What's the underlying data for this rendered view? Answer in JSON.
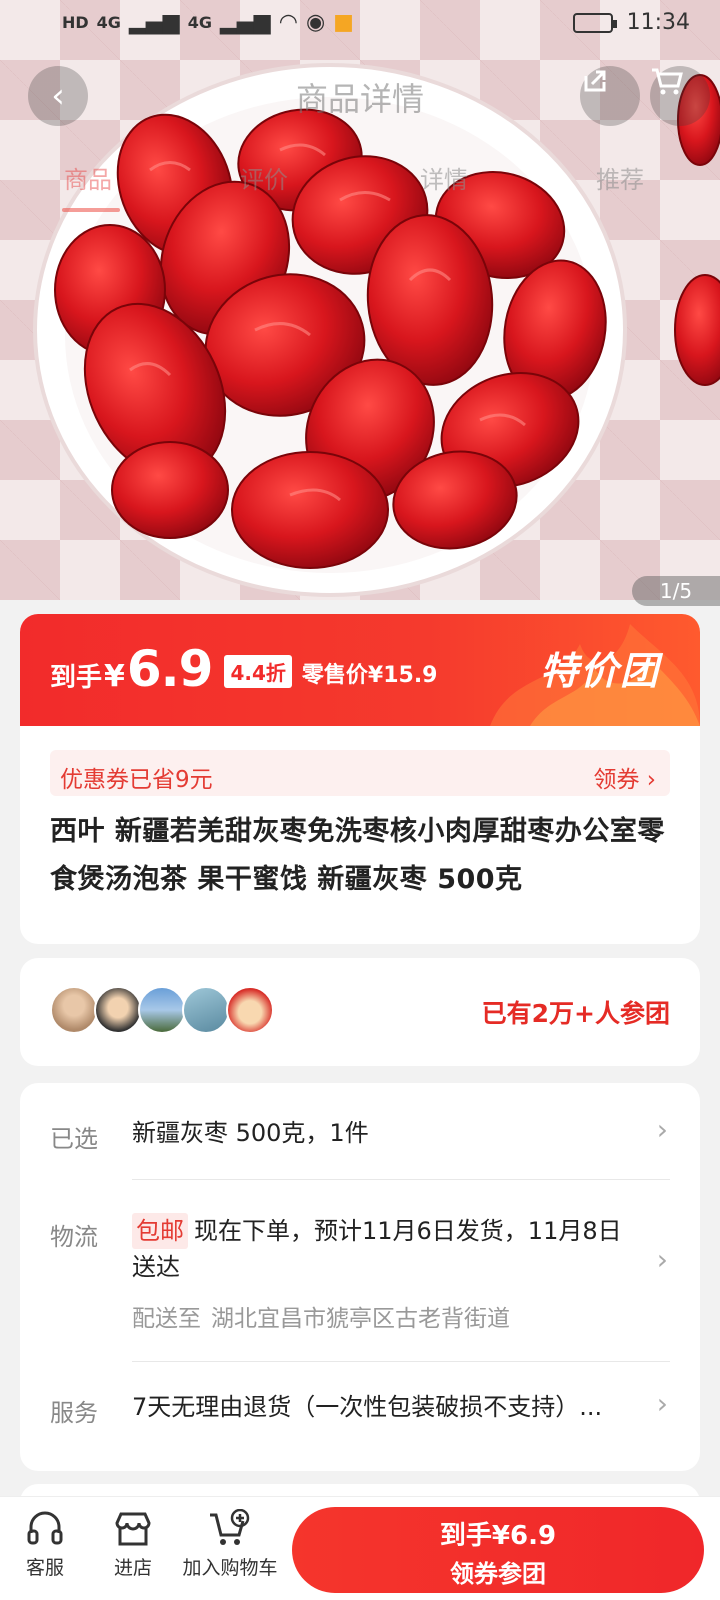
{
  "status_bar": {
    "network_1": "HD",
    "network_2": "HD",
    "signal_1": "4G",
    "signal_2": "4G",
    "time": "11:34"
  },
  "header": {
    "title": "商品详情",
    "back_icon": "back-arrow-icon",
    "share_icon": "share-icon",
    "cart_icon": "cart-icon"
  },
  "tabs": [
    {
      "label": "商品",
      "active": true
    },
    {
      "label": "评价",
      "active": false
    },
    {
      "label": "详情",
      "active": false
    },
    {
      "label": "推荐",
      "active": false
    }
  ],
  "image_counter": "1/5",
  "price": {
    "label": "到手",
    "symbol": "¥",
    "value": "6.9",
    "discount": "4.4折",
    "retail": "零售价¥15.9",
    "promo_tag": "特价团"
  },
  "coupon": {
    "text": "优惠券已省9元",
    "action": "领券"
  },
  "product_title": "西叶 新疆若羌甜灰枣免洗枣核小肉厚甜枣办公室零食煲汤泡茶 果干蜜饯 新疆灰枣 500克",
  "group": {
    "joined_text": "已有2万+人参团"
  },
  "info": {
    "selected": {
      "label": "已选",
      "value": "新疆灰枣 500克，1件"
    },
    "shipping": {
      "label": "物流",
      "tag": "包邮",
      "value": "现在下单，预计11月6日发货，11月8日送达",
      "addr_label": "配送至",
      "addr": "湖北宜昌市猇亭区古老背街道"
    },
    "service": {
      "label": "服务",
      "value": "7天无理由退货（一次性包装破损不支持）..."
    }
  },
  "bottom_bar": {
    "service_label": "客服",
    "store_label": "进店",
    "cart_label": "加入购物车",
    "buy_line1": "到手¥6.9",
    "buy_line2": "领券参团"
  },
  "colors": {
    "accent": "#f22b2b",
    "coupon_bg": "#fdf0ef",
    "date_red": "#c8161e"
  }
}
